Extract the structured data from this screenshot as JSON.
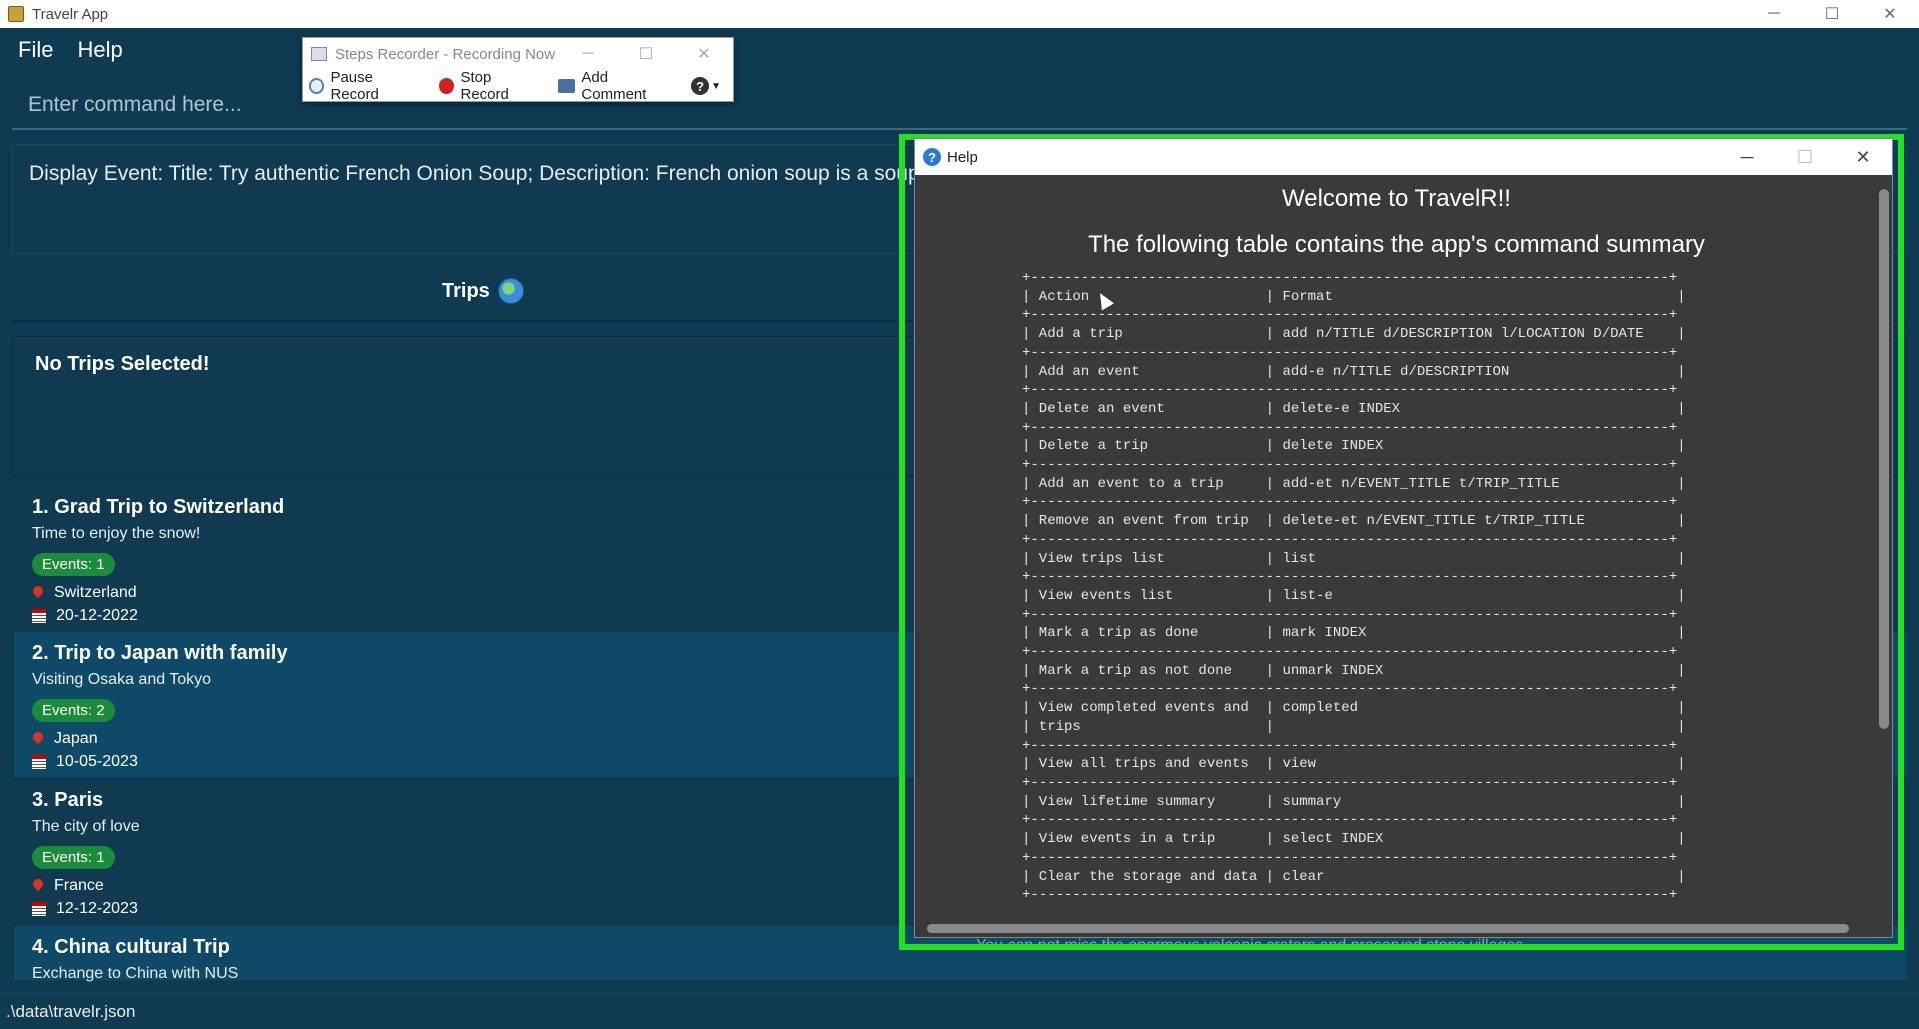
{
  "window": {
    "title": "Travelr App"
  },
  "menu": {
    "file": "File",
    "help": "Help"
  },
  "command": {
    "placeholder": "Enter command here..."
  },
  "result": {
    "text": "Display Event: Title: Try authentic French Onion Soup; Description: French onion soup is a soup u... at specified index of displayed events list"
  },
  "trips_header": {
    "label": "Trips"
  },
  "selected": {
    "text": "No Trips Selected!"
  },
  "trips": [
    {
      "title": "1.  Grad Trip to Switzerland",
      "desc": "Time to enjoy the snow!",
      "events": "Events: 1",
      "location": "Switzerland",
      "date": "20-12-2022"
    },
    {
      "title": "2.  Trip to Japan with family",
      "desc": "Visiting Osaka and Tokyo",
      "events": "Events: 2",
      "location": "Japan",
      "date": "10-05-2023"
    },
    {
      "title": "3.  Paris",
      "desc": "The city of love",
      "events": "Events: 1",
      "location": "France",
      "date": "12-12-2023"
    },
    {
      "title": "4.  China cultural Trip",
      "desc": "Exchange to China with NUS",
      "events": "",
      "location": "",
      "date": ""
    }
  ],
  "status": {
    "path": ".\\data\\travelr.json"
  },
  "recorder": {
    "title": "Steps Recorder - Recording Now",
    "pause": "Pause Record",
    "stop": "Stop Record",
    "comment": "Add Comment"
  },
  "help_window": {
    "title": "Help",
    "welcome": "Welcome to TravelR!!",
    "subtitle": "The following table contains the app's command summary",
    "table": "+----------------------------------------------------------------------------+\n| Action                     | Format                                         |\n+----------------------------------------------------------------------------+\n| Add a trip                 | add n/TITLE d/DESCRIPTION l/LOCATION D/DATE    |\n+----------------------------------------------------------------------------+\n| Add an event               | add-e n/TITLE d/DESCRIPTION                    |\n+----------------------------------------------------------------------------+\n| Delete an event            | delete-e INDEX                                 |\n+----------------------------------------------------------------------------+\n| Delete a trip              | delete INDEX                                   |\n+----------------------------------------------------------------------------+\n| Add an event to a trip     | add-et n/EVENT_TITLE t/TRIP_TITLE              |\n+----------------------------------------------------------------------------+\n| Remove an event from trip  | delete-et n/EVENT_TITLE t/TRIP_TITLE           |\n+----------------------------------------------------------------------------+\n| View trips list            | list                                           |\n+----------------------------------------------------------------------------+\n| View events list           | list-e                                         |\n+----------------------------------------------------------------------------+\n| Mark a trip as done        | mark INDEX                                     |\n+----------------------------------------------------------------------------+\n| Mark a trip as not done    | unmark INDEX                                   |\n+----------------------------------------------------------------------------+\n| View completed events and  | completed                                      |\n| trips                      |                                                |\n+----------------------------------------------------------------------------+\n| View all trips and events  | view                                           |\n+----------------------------------------------------------------------------+\n| View lifetime summary      | summary                                        |\n+----------------------------------------------------------------------------+\n| View events in a trip      | select INDEX                                   |\n+----------------------------------------------------------------------------+\n| Clear the storage and data | clear                                          |\n+----------------------------------------------------------------------------+"
  },
  "stray_text": "You can not miss the enormous volcanic craters and preserved stone villages",
  "colors": {
    "background": "#0e3a52",
    "badge": "#1a8c3a",
    "highlight_frame": "#22e022"
  }
}
